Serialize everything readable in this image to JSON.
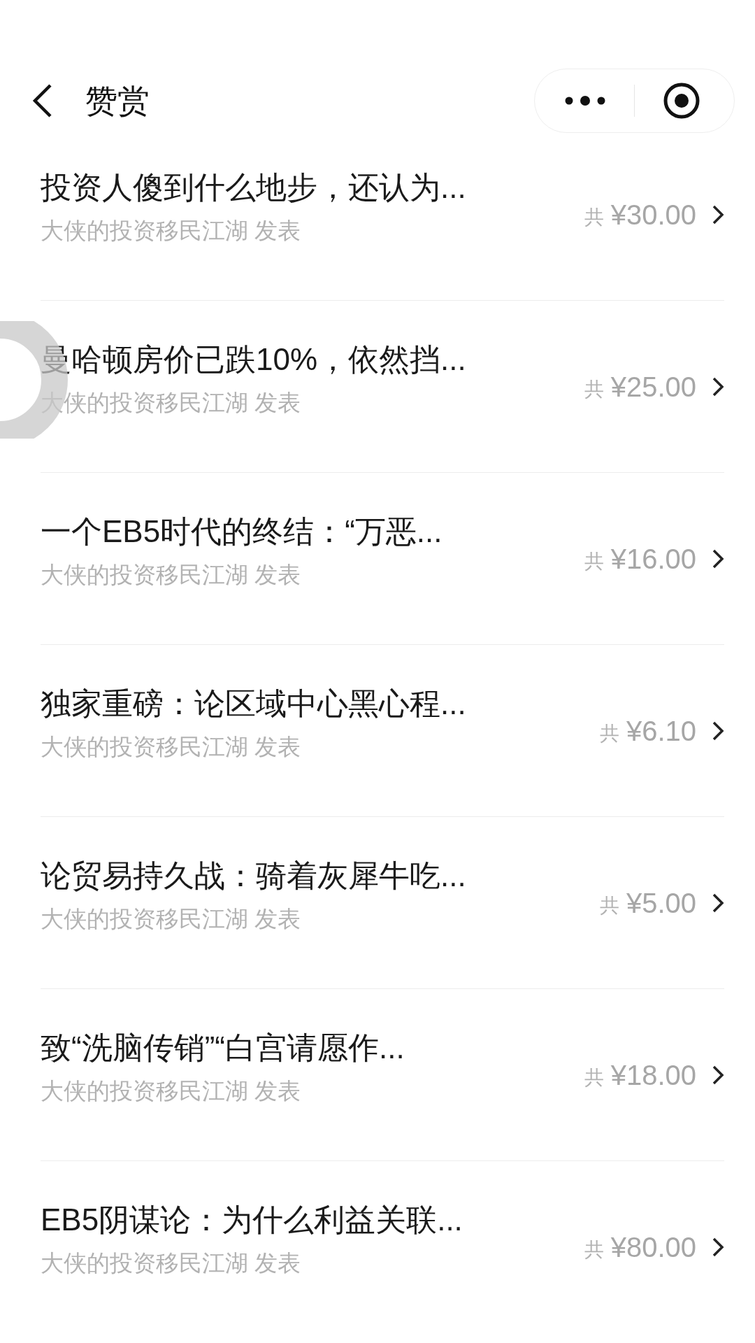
{
  "header": {
    "title": "赞赏"
  },
  "items": [
    {
      "title": "投资人傻到什么地步，还认为...",
      "author": "大侠的投资移民江湖 发表",
      "prefix": "共",
      "amount": "¥30.00"
    },
    {
      "title": "曼哈顿房价已跌10%，依然挡...",
      "author": "大侠的投资移民江湖 发表",
      "prefix": "共",
      "amount": "¥25.00"
    },
    {
      "title": "一个EB5时代的终结：“万恶...",
      "author": "大侠的投资移民江湖 发表",
      "prefix": "共",
      "amount": "¥16.00"
    },
    {
      "title": "独家重磅：论区域中心黑心程...",
      "author": "大侠的投资移民江湖 发表",
      "prefix": "共",
      "amount": "¥6.10"
    },
    {
      "title": "论贸易持久战：骑着灰犀牛吃...",
      "author": "大侠的投资移民江湖 发表",
      "prefix": "共",
      "amount": "¥5.00"
    },
    {
      "title": "致“洗脑传销”“白宫请愿作...",
      "author": "大侠的投资移民江湖 发表",
      "prefix": "共",
      "amount": "¥18.00"
    },
    {
      "title": "EB5阴谋论：为什么利益关联...",
      "author": "大侠的投资移民江湖 发表",
      "prefix": "共",
      "amount": "¥80.00"
    }
  ]
}
